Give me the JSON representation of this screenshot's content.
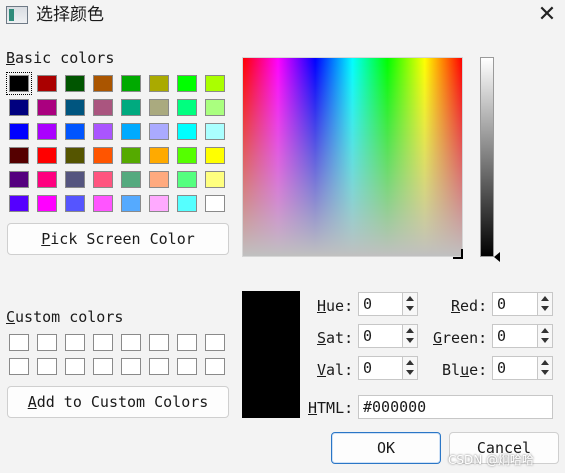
{
  "window": {
    "title": "选择颜色",
    "close_icon": "✕"
  },
  "basic_colors": {
    "label_key": "B",
    "label_rest": "asic colors",
    "selected_index": 0,
    "rows": [
      [
        "#000000",
        "#aa0000",
        "#005500",
        "#aa5500",
        "#00aa00",
        "#aaaa00",
        "#00ff00",
        "#aaff00"
      ],
      [
        "#00007f",
        "#aa007f",
        "#00557f",
        "#aa557f",
        "#00aa7f",
        "#aaaa7f",
        "#00ff7f",
        "#aaff7f"
      ],
      [
        "#0000ff",
        "#aa00ff",
        "#0055ff",
        "#aa55ff",
        "#00aaff",
        "#aaaaff",
        "#00ffff",
        "#aaffff"
      ],
      [
        "#550000",
        "#ff0000",
        "#555500",
        "#ff5500",
        "#55aa00",
        "#ffaa00",
        "#55ff00",
        "#ffff00"
      ],
      [
        "#55007f",
        "#ff007f",
        "#55557f",
        "#ff557f",
        "#55aa7f",
        "#ffaa7f",
        "#55ff7f",
        "#ffff7f"
      ],
      [
        "#5500ff",
        "#ff00ff",
        "#5555ff",
        "#ff55ff",
        "#55aaff",
        "#ffaaff",
        "#55ffff",
        "#ffffff"
      ]
    ]
  },
  "pick_screen_button": {
    "key": "P",
    "rest": "ick Screen Color"
  },
  "custom_colors": {
    "label_key": "C",
    "label_rest": "ustom colors",
    "count": 16
  },
  "add_custom_button": {
    "key": "A",
    "rest": "dd to Custom Colors"
  },
  "fields": {
    "hue": {
      "key": "H",
      "rest": "ue:",
      "value": "0"
    },
    "sat": {
      "key": "S",
      "rest": "at:",
      "value": "0"
    },
    "val": {
      "key": "V",
      "rest": "al:",
      "value": "0"
    },
    "red": {
      "key": "R",
      "rest": "ed:",
      "value": "0"
    },
    "green": {
      "key": "G",
      "rest": "reen:",
      "value": "0"
    },
    "blue": {
      "pre": "Bl",
      "key": "u",
      "rest": "e:",
      "value": "0"
    },
    "html": {
      "key": "H",
      "rest": "TML:",
      "value": "#000000"
    }
  },
  "current_color": "#000000",
  "buttons": {
    "ok": "OK",
    "cancel": "Cancel"
  },
  "watermark": "CSDN @炯哈哈"
}
